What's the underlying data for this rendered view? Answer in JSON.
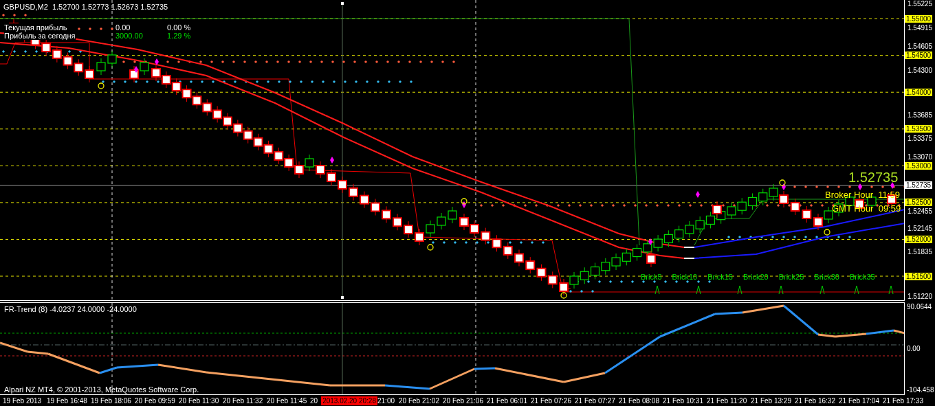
{
  "chart": {
    "title": "GBPUSD,M2  1.52700 1.52773 1.52673 1.52735",
    "profit_rows": [
      {
        "label": "Текущая прибыль",
        "amount": "0.00",
        "percent": "0.00 %",
        "positive": false
      },
      {
        "label": "Прибыль за сегодня",
        "amount": "3000.00",
        "percent": "1.29 %",
        "positive": true
      }
    ],
    "current_price": "1.52735",
    "broker_hour": "Broker Hour  11:59",
    "gmt_hour": "GMT Hour  09:59",
    "brick_labels": [
      "Brick5",
      "Brick10",
      "Brick15",
      "Brick20",
      "Brick25",
      "Brick30",
      "Brick35"
    ]
  },
  "price_axis": [
    {
      "text": "1.55225",
      "kind": "tick"
    },
    {
      "text": "1.55000",
      "kind": "level"
    },
    {
      "text": "1.54915",
      "kind": "tick"
    },
    {
      "text": "1.54605",
      "kind": "tick"
    },
    {
      "text": "1.54500",
      "kind": "level"
    },
    {
      "text": "1.54300",
      "kind": "tick"
    },
    {
      "text": "1.54000",
      "kind": "level"
    },
    {
      "text": "1.53685",
      "kind": "tick"
    },
    {
      "text": "1.53500",
      "kind": "level"
    },
    {
      "text": "1.53375",
      "kind": "tick"
    },
    {
      "text": "1.53070",
      "kind": "tick"
    },
    {
      "text": "1.53000",
      "kind": "level"
    },
    {
      "text": "1.52735",
      "kind": "current"
    },
    {
      "text": "1.52500",
      "kind": "level"
    },
    {
      "text": "1.52455",
      "kind": "tick"
    },
    {
      "text": "1.52145",
      "kind": "tick"
    },
    {
      "text": "1.52000",
      "kind": "level"
    },
    {
      "text": "1.51835",
      "kind": "tick"
    },
    {
      "text": "1.51500",
      "kind": "level"
    },
    {
      "text": "1.51220",
      "kind": "tick"
    }
  ],
  "indicator": {
    "title": "FR-Trend (8) -4.0237 24.0000 -24.0000",
    "axis": [
      "90.0644",
      "0.00",
      "-104.458"
    ],
    "footer": "Alpari NZ MT4, © 2001-2013, MetaQuotes Software Corp."
  },
  "time_axis": [
    {
      "text": "19 Feb 2013",
      "kind": "label"
    },
    {
      "text": "19 Feb 16:48",
      "kind": "label"
    },
    {
      "text": "19 Feb 18:06",
      "kind": "label"
    },
    {
      "text": "20 Feb 09:59",
      "kind": "label"
    },
    {
      "text": "20 Feb 11:30",
      "kind": "label"
    },
    {
      "text": "20 Feb 11:32",
      "kind": "label"
    },
    {
      "text": "20 Feb 11:45",
      "kind": "label"
    },
    {
      "text": "20",
      "kind": "short"
    },
    {
      "text": "2013.02.20 20:28",
      "kind": "cursor"
    },
    {
      "text": "21:00",
      "kind": "short"
    },
    {
      "text": "20 Feb 21:02",
      "kind": "label"
    },
    {
      "text": "20 Feb 21:06",
      "kind": "label"
    },
    {
      "text": "21 Feb 06:01",
      "kind": "label"
    },
    {
      "text": "21 Feb 07:26",
      "kind": "label"
    },
    {
      "text": "21 Feb 07:27",
      "kind": "label"
    },
    {
      "text": "21 Feb 08:08",
      "kind": "label"
    },
    {
      "text": "21 Feb 10:31",
      "kind": "label"
    },
    {
      "text": "21 Feb 11:20",
      "kind": "label"
    },
    {
      "text": "21 Feb 13:29",
      "kind": "label"
    },
    {
      "text": "21 Feb 16:32",
      "kind": "label"
    },
    {
      "text": "21 Feb 17:04",
      "kind": "label"
    },
    {
      "text": "21 Feb 17:33",
      "kind": "label"
    }
  ]
}
